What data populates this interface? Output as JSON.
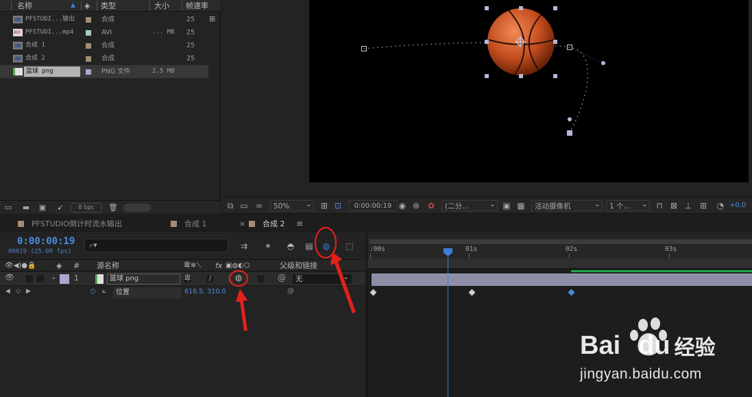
{
  "project": {
    "columns": {
      "name": "名称",
      "type": "类型",
      "size": "大小",
      "fps": "帧速率"
    },
    "items": [
      {
        "name": "PFSTUDI...输出",
        "icon": "composition-icon",
        "swatch": "#a48f73",
        "type": "合成",
        "size": "",
        "fps": "25"
      },
      {
        "name": "PFSTUDI...mp4",
        "icon": "avi-file-icon",
        "swatch": "#a6cdc4",
        "type": "AVI",
        "size": "... MB",
        "fps": "25"
      },
      {
        "name": "合成 1",
        "icon": "composition-icon",
        "swatch": "#a48f73",
        "type": "合成",
        "size": "",
        "fps": "25"
      },
      {
        "name": "合成 2",
        "icon": "composition-icon",
        "swatch": "#a48f73",
        "type": "合成",
        "size": "",
        "fps": "25"
      },
      {
        "name": "篮球 png",
        "icon": "png-file-icon",
        "swatch": "#a9a7cf",
        "type": "PNG 文件",
        "size": "2.5 MB",
        "fps": ""
      }
    ],
    "bpc": "8 bpc"
  },
  "viewer_toolbar": {
    "zoom": "50%",
    "timecode": "0:00:00:19",
    "resolution": "(二分…",
    "camera": "活动摄像机",
    "views": "1 个…",
    "exposure": "+0.0"
  },
  "timeline": {
    "tabs": [
      {
        "label": "PFSTUDIO倒计时流水输出"
      },
      {
        "label": "合成 1"
      },
      {
        "label": "合成 2"
      }
    ],
    "close_glyph": "×",
    "menu_glyph": "≡",
    "current_time": "0:00:00:19",
    "frame_info": "00019 (25.00 fps)",
    "columns": {
      "number": "#",
      "source_name": "源名称",
      "fx": "fx",
      "parent": "父级和链接"
    },
    "layer": {
      "index": "1",
      "name": "篮球 png",
      "parent": "无"
    },
    "property": {
      "name": "位置",
      "value": "616.5, 310.0"
    },
    "ruler": {
      "labels": [
        ":00s",
        "01s",
        "02s",
        "03s"
      ]
    }
  },
  "watermark": {
    "brand_a": "Bai",
    "brand_b": "du",
    "brand_cn": "经验",
    "url": "jingyan.baidu.com"
  },
  "colors": {
    "accent_blue": "#3b7fd6",
    "annotation_red": "#e0211c",
    "render_green": "#1ea84a",
    "layer_bar": "#8d8ea6"
  }
}
